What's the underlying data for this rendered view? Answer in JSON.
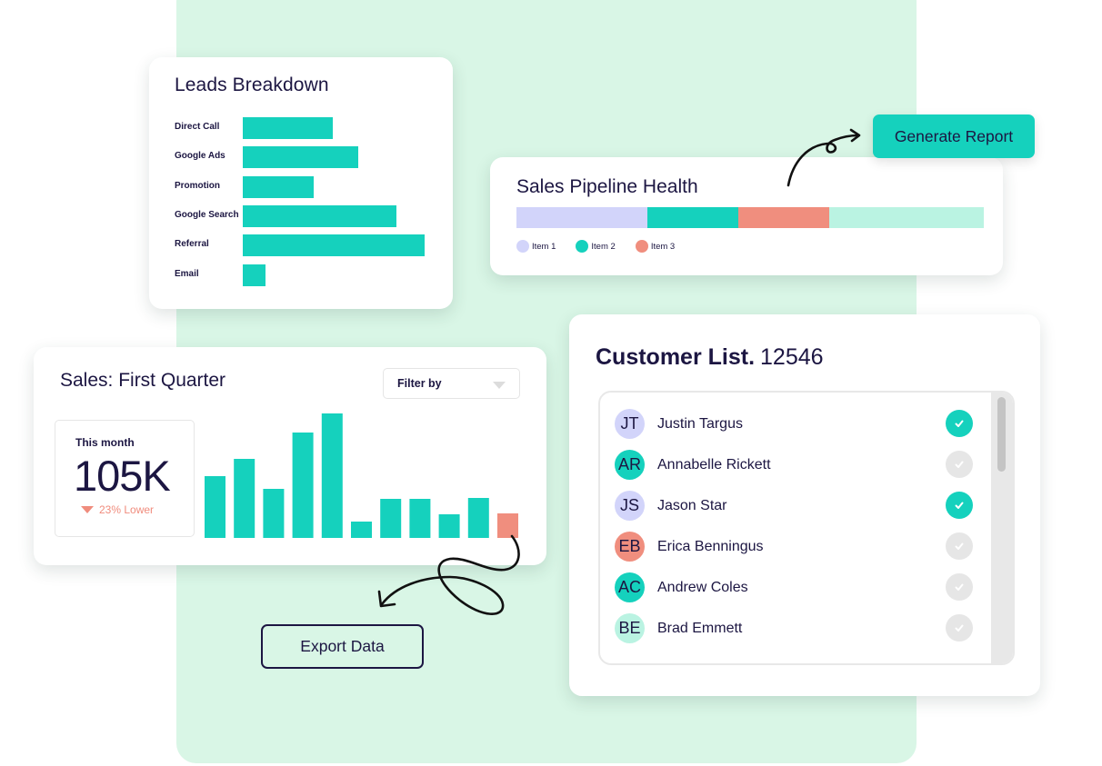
{
  "colors": {
    "teal": "#15d1bd",
    "lavender": "#d2d4fa",
    "salmon": "#f08e7e",
    "mint": "#baf3e2",
    "navy": "#1c1642",
    "background_panel": "#d9f6e6",
    "check_off": "#e6e6e6"
  },
  "leads": {
    "title": "Leads Breakdown",
    "chart_data": {
      "type": "bar",
      "orientation": "horizontal",
      "title": "Leads Breakdown",
      "categories": [
        "Direct Call",
        "Google Ads",
        "Promotion",
        "Google Search",
        "Referral",
        "Email"
      ],
      "values": [
        99,
        127,
        78,
        169,
        200,
        25
      ],
      "xlim": [
        0,
        200
      ],
      "grid": false
    }
  },
  "pipeline": {
    "title": "Sales Pipeline Health",
    "chart_data": {
      "type": "bar",
      "orientation": "stacked-horizontal",
      "title": "Sales Pipeline Health",
      "series": [
        {
          "name": "Item 1",
          "value": 28,
          "color": "#d2d4fa"
        },
        {
          "name": "Item 2",
          "value": 19.5,
          "color": "#15d1bd"
        },
        {
          "name": "Item 3",
          "value": 19.5,
          "color": "#f08e7e"
        },
        {
          "name": "",
          "value": 33,
          "color": "#baf3e2"
        }
      ],
      "unit": "%",
      "legend": [
        "Item 1",
        "Item 2",
        "Item 3"
      ],
      "legend_position": "bottom-left"
    }
  },
  "generate_report": {
    "label": "Generate Report"
  },
  "sales": {
    "title": "Sales: First Quarter",
    "filter": {
      "label": "Filter by"
    },
    "this_month": {
      "label": "This month",
      "value": "105K",
      "change": "23% Lower",
      "direction": "down"
    },
    "chart_data": {
      "type": "bar",
      "title": "Sales: First Quarter",
      "values": [
        68,
        87,
        54,
        116,
        137,
        18,
        43,
        43,
        26,
        44,
        27
      ],
      "highlight_index": 10,
      "highlight_color": "#f08e7e",
      "bar_color": "#15d1bd",
      "ylim": [
        0,
        140
      ],
      "axes": false,
      "grid": false
    }
  },
  "export": {
    "label": "Export Data"
  },
  "customers": {
    "title": "Customer List.",
    "count": "12546",
    "items": [
      {
        "initials": "JT",
        "name": "Justin Targus",
        "avatar_color": "#d2d4fa",
        "checked": true
      },
      {
        "initials": "AR",
        "name": "Annabelle Rickett",
        "avatar_color": "#15d1bd",
        "checked": false
      },
      {
        "initials": "JS",
        "name": "Jason Star",
        "avatar_color": "#d2d4fa",
        "checked": true
      },
      {
        "initials": "EB",
        "name": "Erica Benningus",
        "avatar_color": "#f08e7e",
        "checked": false
      },
      {
        "initials": "AC",
        "name": "Andrew Coles",
        "avatar_color": "#15d1bd",
        "checked": false
      },
      {
        "initials": "BE",
        "name": "Brad Emmett",
        "avatar_color": "#baf3e2",
        "checked": false
      }
    ]
  }
}
